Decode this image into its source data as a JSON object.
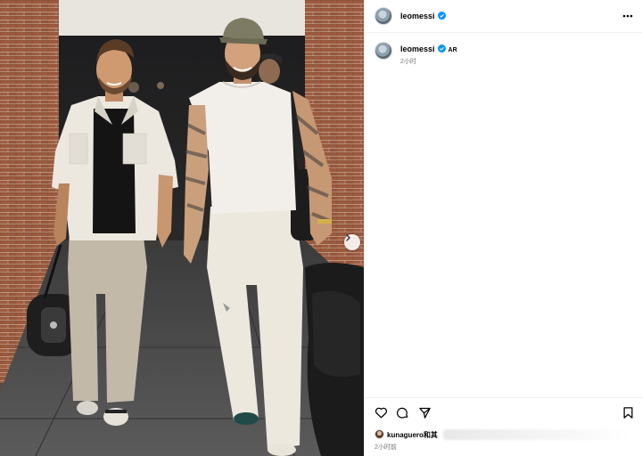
{
  "post": {
    "username": "leomessi",
    "verified_color": "#0095f6",
    "caption_username": "leomessi",
    "caption_badge": "AR",
    "caption_time": "2小时",
    "likes_text": "kunaguero和其",
    "footer_time": "2小时前"
  },
  "icons": {
    "more": "more-horizontal-icon",
    "like": "heart-icon",
    "comment": "comment-icon",
    "share": "send-icon",
    "save": "bookmark-icon",
    "next": "chevron-right-icon"
  },
  "colors": {
    "secondary_text": "#737373",
    "divider": "#efefef",
    "brick": "#8a4a33",
    "floor": "#4a4a4a"
  }
}
